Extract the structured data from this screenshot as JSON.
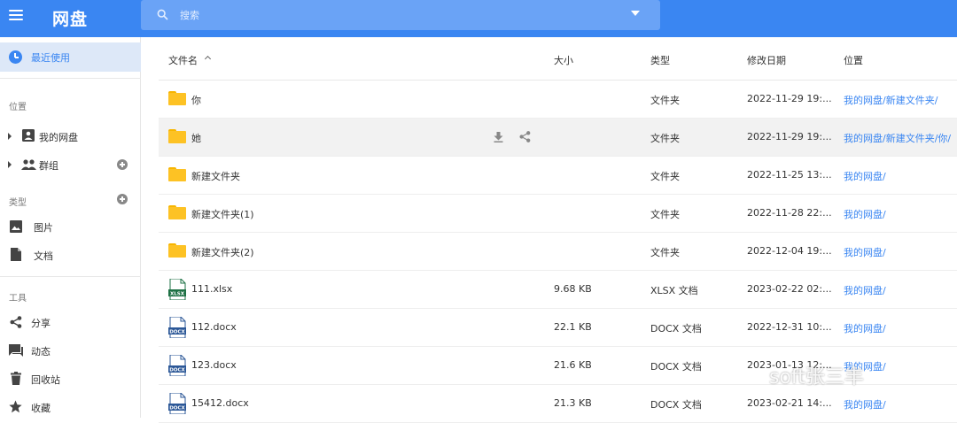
{
  "app": {
    "title": "网盘"
  },
  "search": {
    "placeholder": "搜索"
  },
  "sidebar": {
    "active": {
      "label": "最近使用",
      "icon": "clock-icon"
    },
    "sections": {
      "location": "位置",
      "type": "类型",
      "tools": "工具"
    },
    "location_items": [
      {
        "label": "我的网盘",
        "icon": "drive-icon"
      },
      {
        "label": "群组",
        "icon": "group-icon"
      }
    ],
    "type_items": [
      {
        "label": "图片",
        "icon": "image-icon"
      },
      {
        "label": "文档",
        "icon": "document-icon"
      }
    ],
    "tool_items": [
      {
        "label": "分享",
        "icon": "share-icon"
      },
      {
        "label": "动态",
        "icon": "activity-icon"
      },
      {
        "label": "回收站",
        "icon": "trash-icon"
      },
      {
        "label": "收藏",
        "icon": "star-icon"
      }
    ]
  },
  "table": {
    "headers": {
      "name": "文件名",
      "size": "大小",
      "type": "类型",
      "date": "修改日期",
      "location": "位置"
    },
    "rows": [
      {
        "name": "你",
        "size": "",
        "type": "文件夹",
        "date": "2022-11-29 19:...",
        "location": "我的网盘/新建文件夹/",
        "icon": "folder-icon"
      },
      {
        "name": "她",
        "size": "",
        "type": "文件夹",
        "date": "2022-11-29 19:...",
        "location": "我的网盘/新建文件夹/你/",
        "icon": "folder-icon"
      },
      {
        "name": "新建文件夹",
        "size": "",
        "type": "文件夹",
        "date": "2022-11-25 13:...",
        "location": "我的网盘/",
        "icon": "folder-icon"
      },
      {
        "name": "新建文件夹(1)",
        "size": "",
        "type": "文件夹",
        "date": "2022-11-28 22:...",
        "location": "我的网盘/",
        "icon": "folder-icon"
      },
      {
        "name": "新建文件夹(2)",
        "size": "",
        "type": "文件夹",
        "date": "2022-12-04 19:...",
        "location": "我的网盘/",
        "icon": "folder-icon"
      },
      {
        "name": "111.xlsx",
        "size": "9.68 KB",
        "type": "XLSX 文档",
        "date": "2023-02-22 02:...",
        "location": "我的网盘/",
        "icon": "xlsx-icon",
        "badge": "XLSX"
      },
      {
        "name": "112.docx",
        "size": "22.1 KB",
        "type": "DOCX 文档",
        "date": "2022-12-31 10:...",
        "location": "我的网盘/",
        "icon": "docx-icon",
        "badge": "DOCX"
      },
      {
        "name": "123.docx",
        "size": "21.6 KB",
        "type": "DOCX 文档",
        "date": "2023-01-13 12:...",
        "location": "我的网盘/",
        "icon": "docx-icon",
        "badge": "DOCX"
      },
      {
        "name": "15412.docx",
        "size": "21.3 KB",
        "type": "DOCX 文档",
        "date": "2023-02-21 14:...",
        "location": "我的网盘/",
        "icon": "docx-icon",
        "badge": "DOCX"
      }
    ]
  },
  "watermark": "soft张三丰",
  "colors": {
    "accent": "#3a86f2",
    "folder": "#fdc224",
    "xlsx": "#1e7145",
    "docx": "#2b5797"
  }
}
